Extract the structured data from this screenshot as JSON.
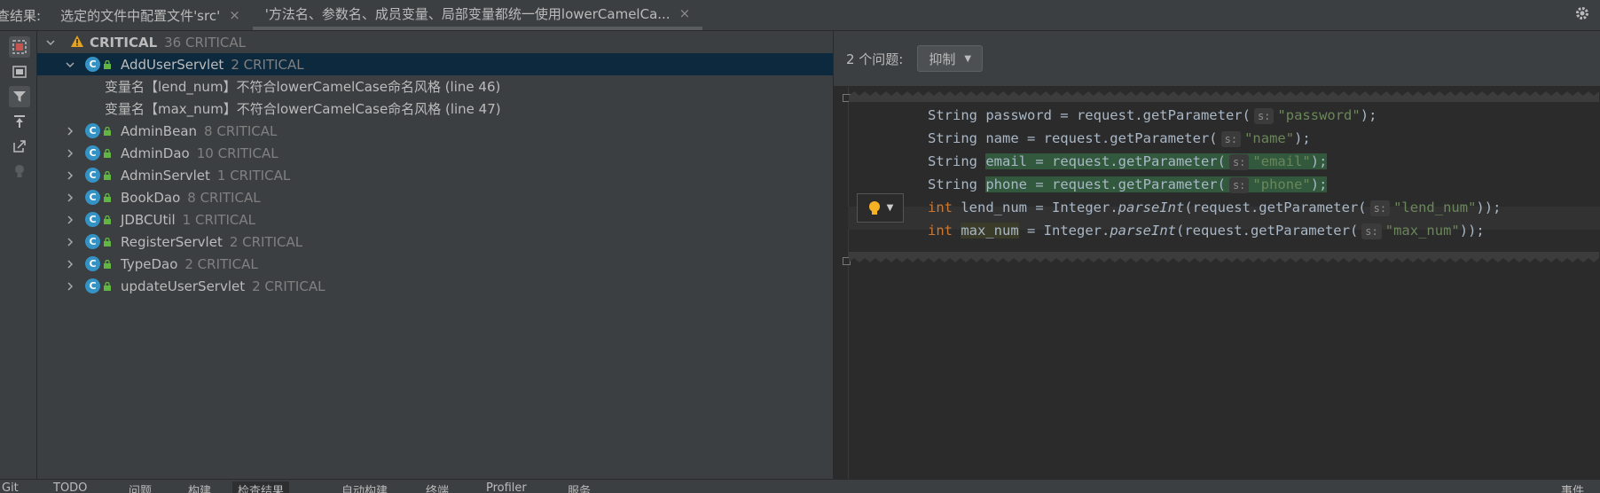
{
  "header": {
    "prefix": "查结果:",
    "tabs": [
      {
        "label": "选定的文件中配置文件'src'",
        "close": "×"
      },
      {
        "label": "'方法名、参数名、成员变量、局部变量都统一使用lowerCamelCa...",
        "close": "×"
      }
    ],
    "settings_icon": "gear-icon"
  },
  "toolbar_icons": [
    "inspection-icon",
    "group-icon",
    "filter-icon",
    "export-icon",
    "navigate-icon",
    "lightbulb-icon"
  ],
  "tree": {
    "root": {
      "label": "CRITICAL",
      "count": "36 CRITICAL"
    },
    "expanded": {
      "name": "AddUserServlet",
      "count": "2 CRITICAL",
      "problems": [
        "变量名【lend_num】不符合lowerCamelCase命名风格 (line 46)",
        "变量名【max_num】不符合lowerCamelCase命名风格 (line 47)"
      ]
    },
    "classes": [
      {
        "name": "AdminBean",
        "count": "8 CRITICAL"
      },
      {
        "name": "AdminDao",
        "count": "10 CRITICAL"
      },
      {
        "name": "AdminServlet",
        "count": "1 CRITICAL"
      },
      {
        "name": "BookDao",
        "count": "8 CRITICAL"
      },
      {
        "name": "JDBCUtil",
        "count": "1 CRITICAL"
      },
      {
        "name": "RegisterServlet",
        "count": "2 CRITICAL"
      },
      {
        "name": "TypeDao",
        "count": "2 CRITICAL"
      },
      {
        "name": "updateUserServlet",
        "count": "2 CRITICAL"
      }
    ]
  },
  "problems_panel": {
    "count_label": "2 个问题:",
    "suppress_label": "抑制"
  },
  "code": {
    "hint": "s:",
    "l1": {
      "a": "String password = request.getParameter(",
      "s": "\"password\"",
      "b": ");"
    },
    "l2": {
      "a": "String name = request.getParameter(",
      "s": "\"name\"",
      "b": ");"
    },
    "l3": {
      "a": "String ",
      "g": "email = request.getParameter(",
      "s": "\"email\"",
      "b": ");"
    },
    "l4": {
      "a": "String ",
      "g": "phone = request.getParameter(",
      "s": "\"phone\"",
      "b": ");"
    },
    "l5": {
      "kw": "int",
      "v": " lend_num",
      "a": " = Integer.",
      "m": "parseInt",
      "c": "(request.getParameter(",
      "s": "\"lend_num\"",
      "b": "));"
    },
    "l6": {
      "kw": "int",
      "v": "max_num",
      "a": " = Integer.",
      "m": "parseInt",
      "c": "(request.getParameter(",
      "s": "\"max_num\"",
      "b": "));"
    }
  },
  "bottom": {
    "items": [
      "Git",
      "TODO",
      "问题",
      "构建",
      "检查结果",
      "自动构建",
      "终端",
      "Profiler",
      "服务"
    ],
    "right": "事件"
  }
}
